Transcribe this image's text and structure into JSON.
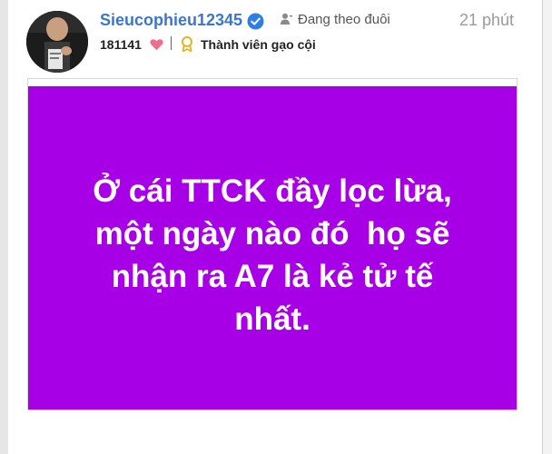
{
  "post": {
    "username": "Sieucophieu12345",
    "follow_label": "Đang theo đuôi",
    "time": "21 phút",
    "likes": "181141",
    "rank_label": "Thành viên gạo cội",
    "image_text": [
      "Ở cái TTCK đầy lọc lừa,",
      "một ngày nào đó  họ sẽ",
      "nhận ra A7 là kẻ tử tế",
      "nhất."
    ]
  },
  "icons": {
    "verified": "verified-check-icon",
    "follow": "person-icon",
    "heart": "heart-icon",
    "medal": "medal-icon"
  },
  "colors": {
    "username": "#3b76c8",
    "verified": "#2f7ee8",
    "heart": "#ef6f8a",
    "medal": "#e6b422",
    "image_bg": "#a800e6"
  }
}
